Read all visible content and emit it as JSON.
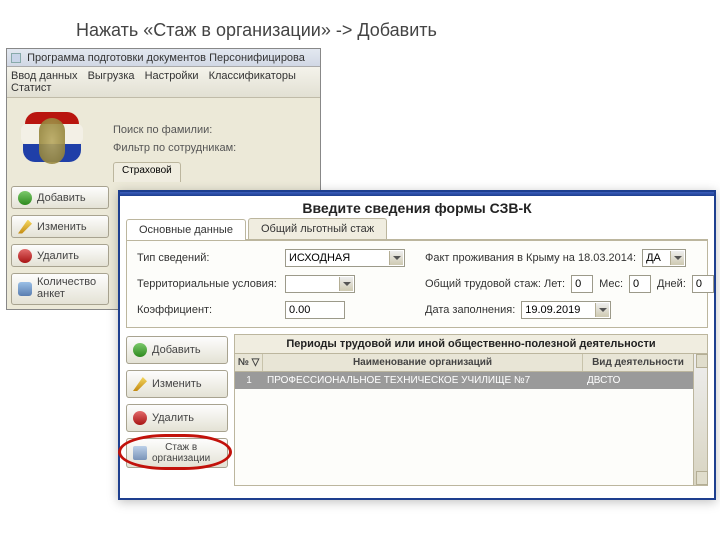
{
  "instruction": "Нажать «Стаж в организации» -> Добавить",
  "back": {
    "title": "Программа подготовки документов Персонифицирова",
    "menu": {
      "vvod": "Ввод данных",
      "vyg": "Выгрузка",
      "nast": "Настройки",
      "klass": "Классификаторы",
      "stat": "Статист"
    },
    "search_label": "Поиск по фамилии:",
    "filter_label": "Фильтр по сотрудникам:",
    "tab": "Страховой",
    "buttons": {
      "add": "Добавить",
      "edit": "Изменить",
      "del": "Удалить",
      "cnt_l1": "Количество",
      "cnt_l2": "анкет"
    }
  },
  "front": {
    "title": "Введите сведения формы СЗВ-К",
    "tabs": {
      "main": "Основные данные",
      "priv": "Общий льготный стаж"
    },
    "labels": {
      "tip": "Тип сведений:",
      "terr": "Территориальные условия:",
      "koef": "Коэффициент:",
      "krym": "Факт проживания в Крыму на 18.03.2014:",
      "stazh": "Общий трудовой стаж: Лет:",
      "mes": "Мес:",
      "dney": "Дней:",
      "date": "Дата заполнения:"
    },
    "values": {
      "tip": "ИСХОДНАЯ",
      "terr": "",
      "koef": "0.00",
      "krym": "ДА",
      "let": "0",
      "mes": "0",
      "dney": "0",
      "date": "19.09.2019"
    },
    "side": {
      "add": "Добавить",
      "edit": "Изменить",
      "del": "Удалить",
      "stazh_l1": "Стаж в",
      "stazh_l2": "организации"
    },
    "periods": {
      "title": "Периоды трудовой или иной общественно-полезной деятельности",
      "headers": {
        "num": "№ ▽",
        "org": "Наименование организаций",
        "act": "Вид деятельности"
      },
      "rows": [
        {
          "n": "1",
          "org": "ПРОФЕССИОНАЛЬНОЕ ТЕХНИЧЕСКОЕ УЧИЛИЩЕ №7",
          "act": "ДВСТО"
        }
      ]
    }
  }
}
